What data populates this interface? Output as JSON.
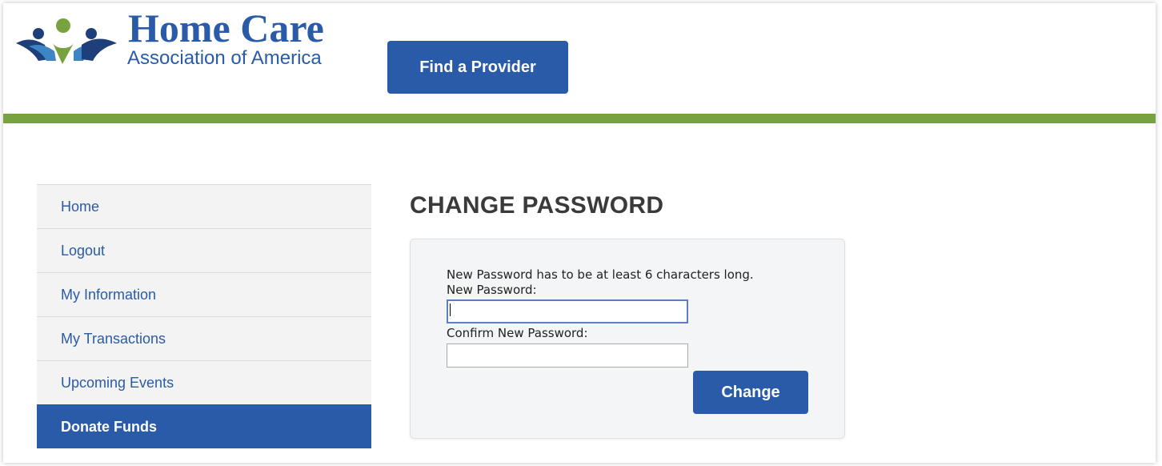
{
  "header": {
    "logo_main": "Home Care",
    "logo_sub": "Association of America",
    "find_provider_label": "Find a Provider"
  },
  "colors": {
    "brand_blue": "#2a5ba8",
    "accent_green": "#78a240",
    "logo_light_blue": "#3d86c6"
  },
  "sidebar": {
    "items": [
      {
        "label": "Home",
        "active": false
      },
      {
        "label": "Logout",
        "active": false
      },
      {
        "label": "My Information",
        "active": false
      },
      {
        "label": "My Transactions",
        "active": false
      },
      {
        "label": "Upcoming Events",
        "active": false
      },
      {
        "label": "Donate Funds",
        "active": true
      }
    ]
  },
  "main": {
    "title": "CHANGE PASSWORD",
    "hint": "New Password has to be at least 6 characters long.",
    "new_password_label": "New Password:",
    "new_password_value": "",
    "confirm_password_label": "Confirm New Password:",
    "confirm_password_value": "",
    "change_button_label": "Change"
  }
}
